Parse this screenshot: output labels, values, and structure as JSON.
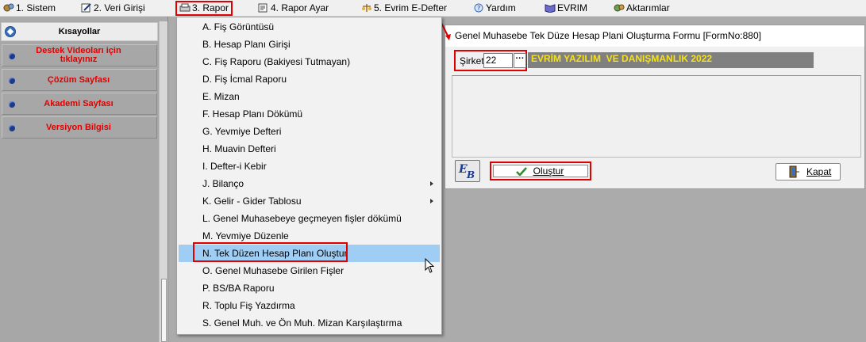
{
  "menubar": {
    "items": [
      {
        "label": "1. Sistem",
        "icon": "gear-icon"
      },
      {
        "label": "2.    Veri Girişi",
        "icon": "pencil-icon"
      },
      {
        "label": "3.  Rapor",
        "icon": "printer-icon"
      },
      {
        "label": "4.   Rapor Ayar",
        "icon": "report-settings-icon"
      },
      {
        "label": "5. Evrim E-Defter",
        "icon": "scale-icon"
      },
      {
        "label": "Yardım",
        "icon": "help-icon"
      },
      {
        "label": "EVRIM",
        "icon": "book-icon"
      },
      {
        "label": "Aktarımlar",
        "icon": "transfer-icon"
      }
    ]
  },
  "sidebar": {
    "header": "Kısayollar",
    "items": [
      {
        "label": "Destek Videoları için tıklayınız"
      },
      {
        "label": "Çözüm Sayfası"
      },
      {
        "label": "Akademi Sayfası"
      },
      {
        "label": "Versiyon Bilgisi"
      }
    ]
  },
  "rapor_menu": {
    "items": [
      {
        "label": "A.   Fiş Görüntüsü"
      },
      {
        "label": "B.   Hesap Planı Girişi"
      },
      {
        "label": "C.   Fiş Raporu (Bakiyesi Tutmayan)"
      },
      {
        "label": "D.   Fiş İcmal Raporu"
      },
      {
        "label": "E.   Mizan"
      },
      {
        "label": "F.   Hesap Planı Dökümü"
      },
      {
        "label": "G.   Yevmiye Defteri"
      },
      {
        "label": "H.   Muavin Defteri"
      },
      {
        "label": "I.   Defter-i Kebir"
      },
      {
        "label": "J.   Bilanço"
      },
      {
        "label": "K.   Gelir - Gider Tablosu"
      },
      {
        "label": "L.   Genel Muhasebeye geçmeyen fişler dökümü"
      },
      {
        "label": "M.   Yevmiye Düzenle"
      },
      {
        "label": "N.  Tek Düzen Hesap Planı Oluştur"
      },
      {
        "label": "O. Genel Muhasebe Girilen Fişler"
      },
      {
        "label": "P. BS/BA Raporu"
      },
      {
        "label": "R. Toplu Fiş Yazdırma"
      },
      {
        "label": "S. Genel Muh. ve Ön Muh. Mizan Karşılaştırma"
      }
    ],
    "selected_index": 13
  },
  "form": {
    "title": "Genel Muhasebe Tek Düze Hesap Plani Oluşturma Formu [FormNo:880]",
    "sirket_label": "Şirket",
    "sirket_value": "22",
    "sirket_browse": "···",
    "company_name": "EVRİM YAZILIM  VE DANIŞMANLIK 2022",
    "olustur_label": "Oluştur",
    "kapat_label": "Kapat"
  },
  "colors": {
    "highlight_red": "#e00000",
    "selection_blue": "#9fcdf3",
    "company_text": "#f5e020",
    "sidebar_text": "#e00000"
  }
}
